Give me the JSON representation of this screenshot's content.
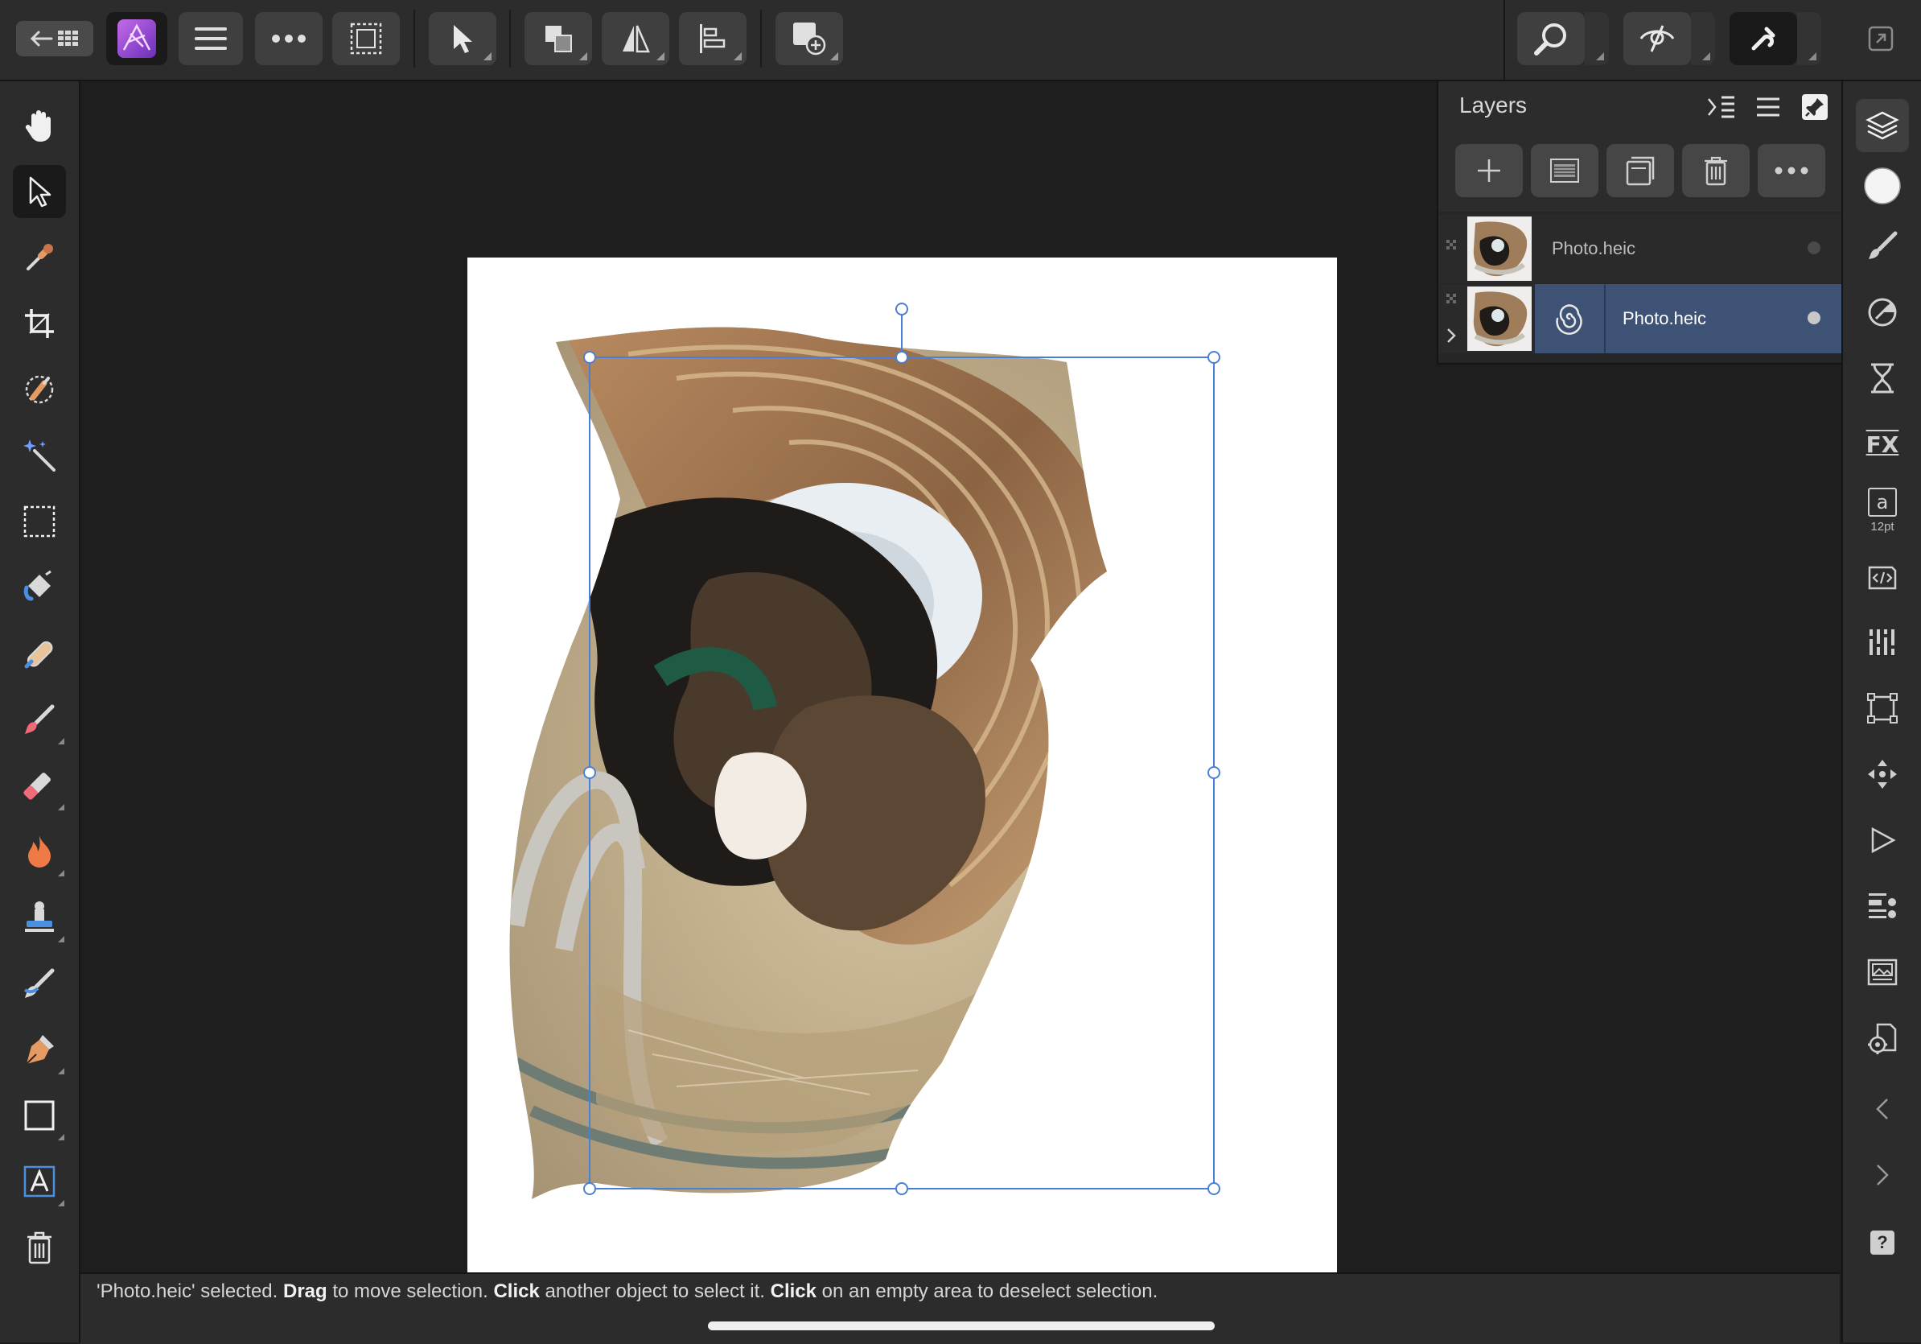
{
  "toolbar": {
    "left_group": [
      "back-arrow-icon",
      "grid-icon"
    ],
    "persona": "photo-persona-icon",
    "buttons": [
      "menu-icon",
      "more-icon",
      "selection-icon",
      "move-tool-icon",
      "arrange-icon",
      "flip-icon",
      "align-icon",
      "insert-icon"
    ],
    "right_group": [
      "zoom-icon",
      "view-quality-icon",
      "snapping-icon",
      "fullscreen-icon"
    ]
  },
  "left_tools": [
    "hand-icon",
    "move-icon",
    "color-picker-icon",
    "crop-icon",
    "selection-brush-icon",
    "magic-wand-icon",
    "marquee-icon",
    "flood-fill-icon",
    "healing-brush-icon",
    "paint-brush-icon",
    "erase-brush-icon",
    "burn-icon",
    "clone-icon",
    "smudge-icon",
    "pen-icon",
    "rectangle-icon",
    "text-icon",
    "trash-icon"
  ],
  "right_studio": {
    "items": [
      "layers-icon",
      "color-icon",
      "brushes-icon",
      "adjustments-icon",
      "history-icon",
      "fx-icon",
      "text-style-icon",
      "text-source-icon",
      "channels-icon",
      "transform-icon",
      "navigator-icon",
      "macro-icon",
      "stock-icon",
      "export-icon",
      "settings-icon",
      "prev-icon",
      "next-icon",
      "help-icon"
    ],
    "text_size": "12pt",
    "text_letter": "a",
    "fx_label": "FX",
    "help_label": "?"
  },
  "layers_panel": {
    "title": "Layers",
    "actions": [
      "add-layer-icon",
      "mask-icon",
      "group-icon",
      "delete-layer-icon",
      "more-icon"
    ],
    "rows": [
      {
        "name": "Photo.heic",
        "selected": false
      },
      {
        "name": "Photo.heic",
        "selected": true,
        "child": "twirl-filter-icon"
      }
    ]
  },
  "status": {
    "p1": "'Photo.heic' selected. ",
    "b1": "Drag",
    "p2": " to move selection. ",
    "b2": "Click",
    "p3": " another object to select it. ",
    "b3": "Click",
    "p4": " on an empty area to deselect selection."
  },
  "colors": {
    "accent": "#4a7fd6",
    "selected_row": "#3e5275",
    "persona_purple": "#9b4dd6"
  }
}
